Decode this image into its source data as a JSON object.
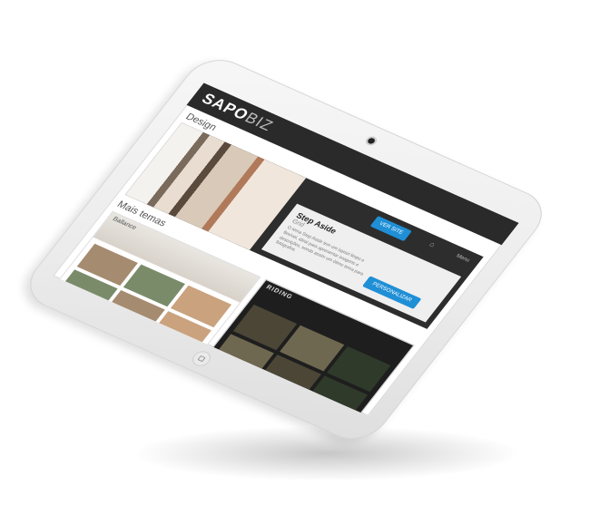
{
  "header": {
    "logo_bold": "SAPO",
    "logo_light": "BIZ"
  },
  "design": {
    "title": "Design",
    "pill_label": "Ver site",
    "nav_label": "Menu",
    "theme_name": "Step Aside",
    "theme_sub": "Grid",
    "theme_desc": "O tema Step Aside tem um layout limpo e flexível, ideal para apresentar imagens e descrições, sendo assim um ótimo tema para fotógrafos.",
    "customize_label": "Personalizar"
  },
  "more": {
    "title": "Mais temas",
    "themes": [
      {
        "label": "Ballance"
      },
      {
        "label": "RIDING"
      }
    ]
  },
  "colors": {
    "accent": "#1f8fd6",
    "topbar": "#2a2a2a",
    "device": "#f2f2f2"
  }
}
